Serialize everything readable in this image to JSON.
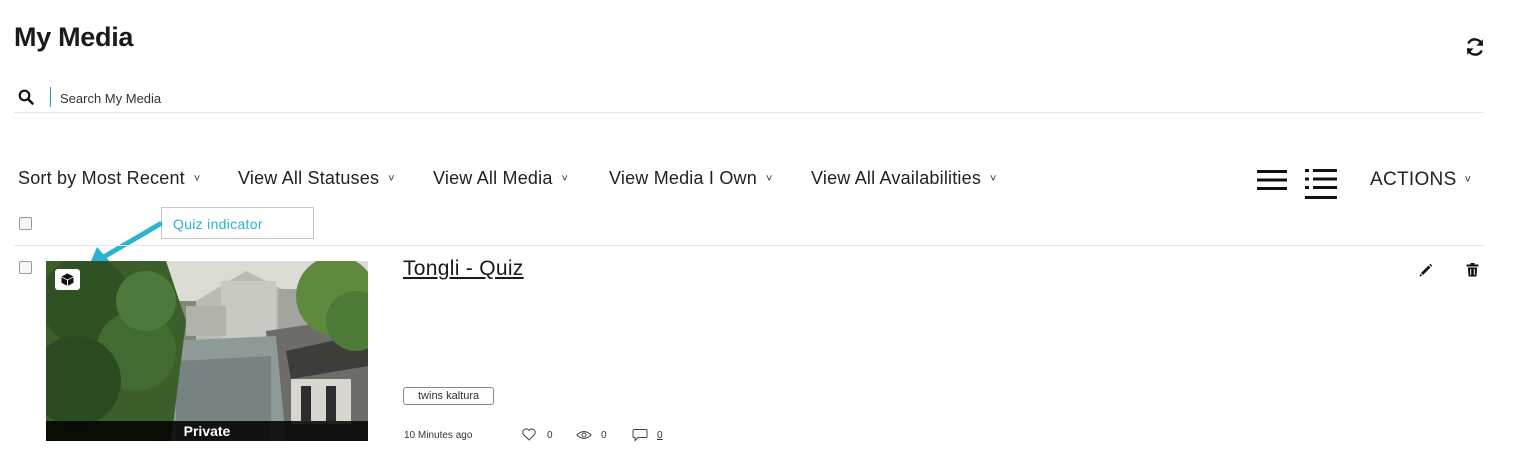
{
  "page": {
    "title": "My Media"
  },
  "search": {
    "placeholder": "Search My Media"
  },
  "filters": {
    "sort": "Sort by Most Recent",
    "statuses": "View All Statuses",
    "media": "View All Media",
    "owner": "View Media I Own",
    "availabilities": "View All Availabilities"
  },
  "toolbar": {
    "actions_label": "ACTIONS"
  },
  "annotation": {
    "callout_text": "Quiz indicator",
    "accent_color": "#2bb3cf"
  },
  "media_items": [
    {
      "title": "Tongli - Quiz",
      "status": "Private",
      "tag": "twins kaltura",
      "time": "10 Minutes ago",
      "likes": "0",
      "views": "0",
      "comments": "0",
      "badge_icon": "quiz-cube-icon"
    }
  ]
}
